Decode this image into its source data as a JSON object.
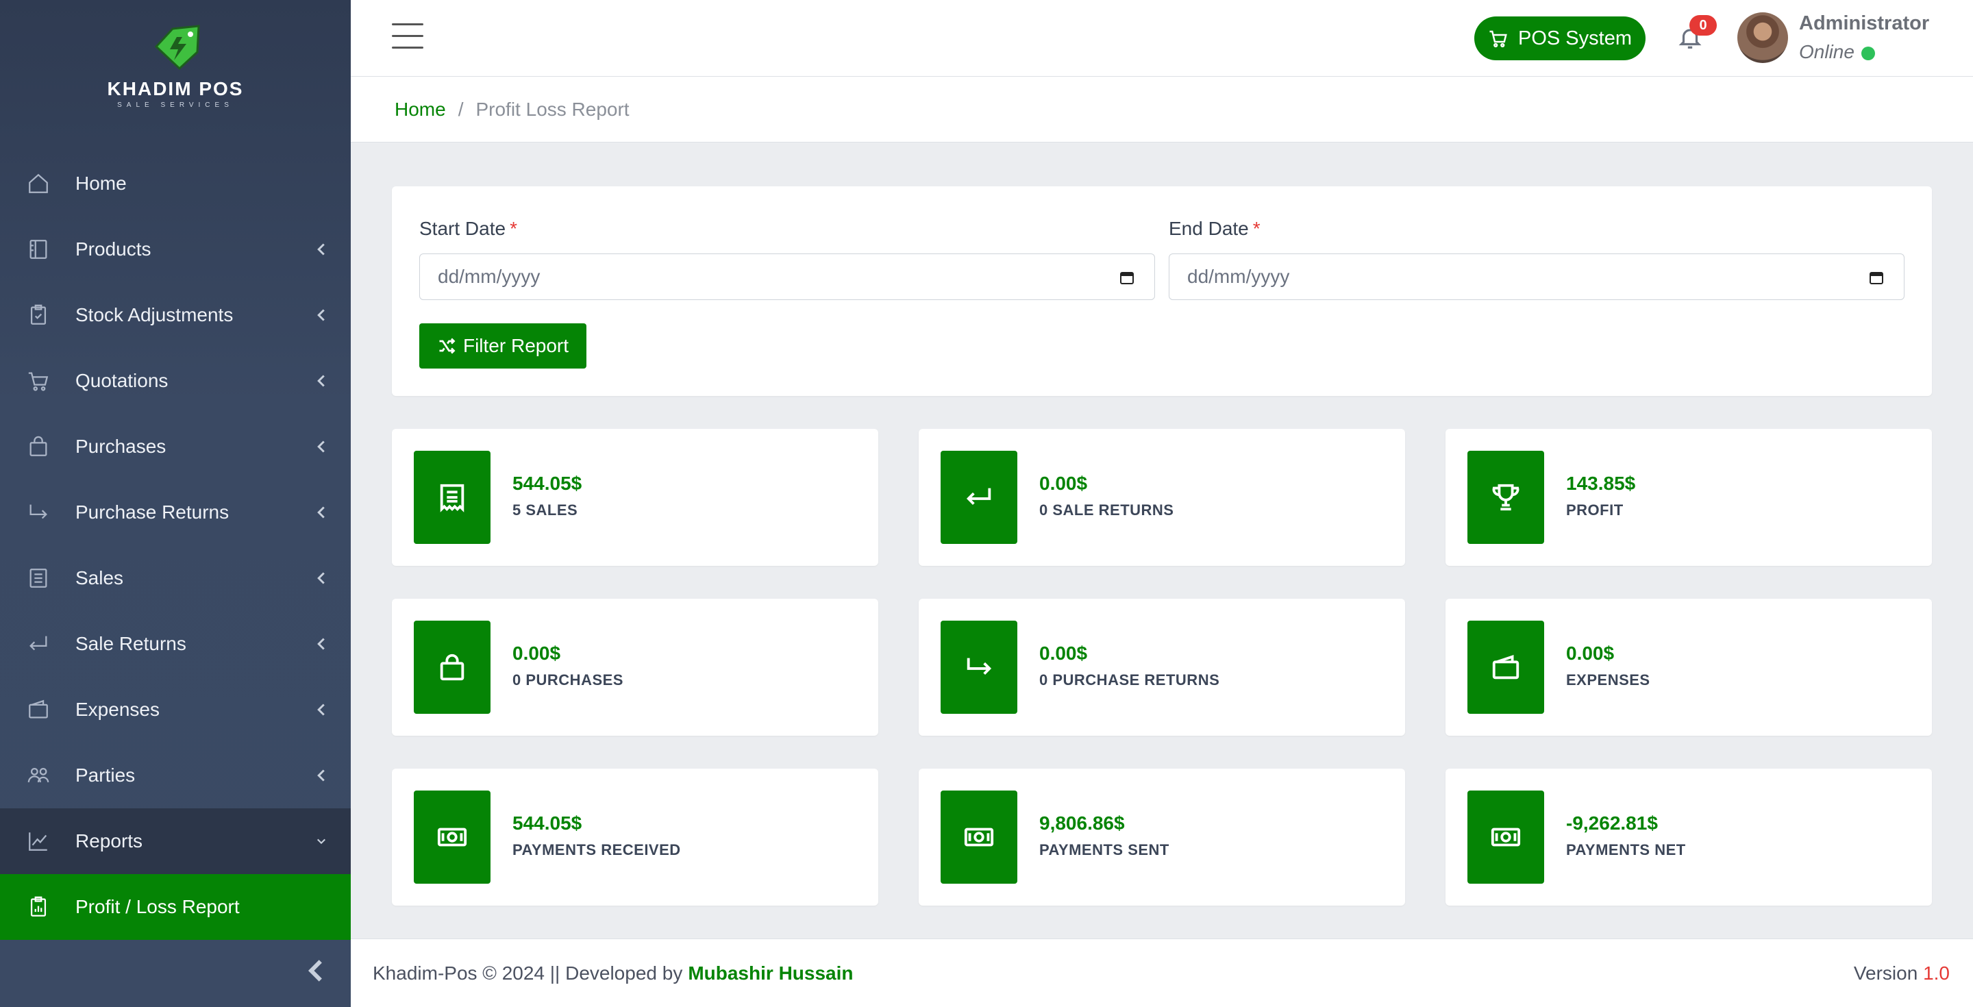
{
  "brand": {
    "name": "KHADIM POS",
    "tagline": "SALE SERVICES"
  },
  "sidebar": {
    "items": [
      {
        "label": "Home",
        "icon": "home-icon"
      },
      {
        "label": "Products",
        "icon": "book-icon"
      },
      {
        "label": "Stock Adjustments",
        "icon": "clipboard-check-icon"
      },
      {
        "label": "Quotations",
        "icon": "cart-icon"
      },
      {
        "label": "Purchases",
        "icon": "bag-icon"
      },
      {
        "label": "Purchase Returns",
        "icon": "arrow-return-right-icon"
      },
      {
        "label": "Sales",
        "icon": "list-icon"
      },
      {
        "label": "Sale Returns",
        "icon": "arrow-return-left-icon"
      },
      {
        "label": "Expenses",
        "icon": "wallet-icon"
      },
      {
        "label": "Parties",
        "icon": "people-icon"
      },
      {
        "label": "Reports",
        "icon": "graph-icon"
      },
      {
        "label": "Profit / Loss Report",
        "icon": "clipboard-data-icon"
      }
    ]
  },
  "topbar": {
    "pos_button": "POS System",
    "notification_count": "0",
    "user_name": "Administrator",
    "user_status": "Online"
  },
  "breadcrumb": {
    "home": "Home",
    "separator": "/",
    "current": "Profit Loss Report"
  },
  "filter": {
    "start_label": "Start Date",
    "end_label": "End Date",
    "required_mark": "*",
    "start_placeholder": "dd/mm/yyyy",
    "end_placeholder": "dd/mm/yyyy",
    "button": "Filter Report"
  },
  "stats": [
    {
      "value": "544.05$",
      "label": "5 SALES",
      "icon": "receipt-icon"
    },
    {
      "value": "0.00$",
      "label": "0 SALE RETURNS",
      "icon": "arrow-return-left-icon"
    },
    {
      "value": "143.85$",
      "label": "PROFIT",
      "icon": "trophy-icon"
    },
    {
      "value": "0.00$",
      "label": "0 PURCHASES",
      "icon": "bag-icon"
    },
    {
      "value": "0.00$",
      "label": "0 PURCHASE RETURNS",
      "icon": "arrow-return-right-icon"
    },
    {
      "value": "0.00$",
      "label": "EXPENSES",
      "icon": "wallet-icon"
    },
    {
      "value": "544.05$",
      "label": "PAYMENTS RECEIVED",
      "icon": "cash-icon"
    },
    {
      "value": "9,806.86$",
      "label": "PAYMENTS SENT",
      "icon": "cash-icon"
    },
    {
      "value": "-9,262.81$",
      "label": "PAYMENTS NET",
      "icon": "cash-icon"
    }
  ],
  "footer": {
    "text": "Khadim-Pos © 2024 || Developed by",
    "developer": "Mubashir Hussain",
    "version_label": "Version",
    "version": "1.0"
  },
  "colors": {
    "accent": "#058405",
    "sidebar": "#3a4963",
    "danger": "#e53935",
    "online": "#2ec15a"
  }
}
